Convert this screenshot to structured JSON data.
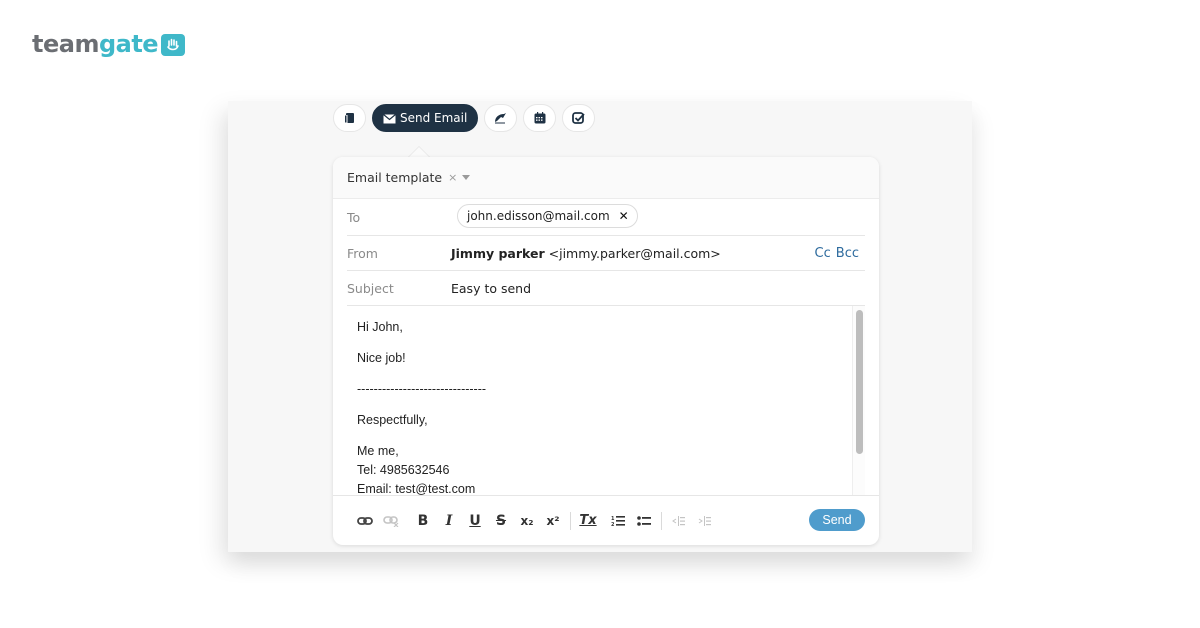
{
  "brand": {
    "name_part1": "team",
    "name_part2": "gate",
    "logo_icon": "hand-heart-icon",
    "color": "#3fb8c9"
  },
  "toolbar": {
    "items": [
      {
        "name": "notes",
        "icon": "note-icon",
        "label": ""
      },
      {
        "name": "send-email",
        "icon": "envelope-icon",
        "label": "Send Email",
        "active": true
      },
      {
        "name": "log-call",
        "icon": "phone-pen-icon",
        "label": ""
      },
      {
        "name": "schedule",
        "icon": "calendar-icon",
        "label": ""
      },
      {
        "name": "task",
        "icon": "checkbox-icon",
        "label": ""
      }
    ]
  },
  "compose": {
    "template": {
      "label": "Email template",
      "clear": "×"
    },
    "to": {
      "label": "To",
      "recipient": "john.edisson@mail.com",
      "remove": "×"
    },
    "from": {
      "label": "From",
      "name": "Jimmy parker",
      "email": "<jimmy.parker@mail.com>",
      "cc": "Cc",
      "bcc": "Bcc"
    },
    "subject": {
      "label": "Subject",
      "value": "Easy to send"
    },
    "body": {
      "greeting": "Hi John,",
      "line1": "Nice job!",
      "divider": "-------------------------------",
      "closing": "Respectfully,",
      "sig_name": "Me me,",
      "sig_tel": "Tel: 4985632546",
      "sig_email": "Email: test@test.com"
    },
    "format_toolbar": {
      "link": "link-icon",
      "unlink": "unlink-icon",
      "bold": "B",
      "italic": "I",
      "underline": "U",
      "strike": "S",
      "subscript": "x₂",
      "superscript": "x²",
      "clear_format": "Tx",
      "ordered_list": "ordered-list-icon",
      "bullet_list": "bullet-list-icon",
      "outdent": "outdent-icon",
      "indent": "indent-icon"
    },
    "send_label": "Send",
    "send_color": "#4f9ccc"
  }
}
